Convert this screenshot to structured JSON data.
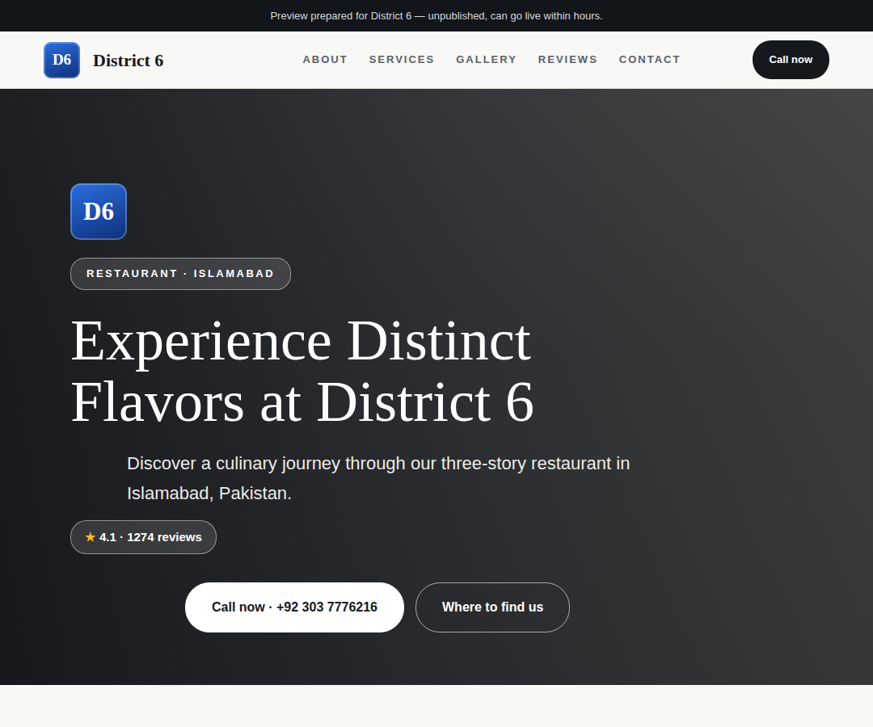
{
  "banner": "Preview prepared for District 6 — unpublished, can go live within hours.",
  "brand": {
    "logo": "D6",
    "name": "District 6"
  },
  "nav": [
    {
      "label": "ABOUT"
    },
    {
      "label": "SERVICES"
    },
    {
      "label": "GALLERY"
    },
    {
      "label": "REVIEWS"
    },
    {
      "label": "CONTACT"
    }
  ],
  "nav_cta": "Call now",
  "hero": {
    "logo": "D6",
    "tag": "RESTAURANT · ISLAMABAD",
    "title": "Experience Distinct Flavors at District 6",
    "subtitle": "Discover a culinary journey through our three-story restaurant in Islamabad, Pakistan.",
    "rating": {
      "star": "★",
      "text": "4.1 · 1274 reviews"
    },
    "buttons": [
      {
        "label": "Call now · +92 303 7776216",
        "kind": "primary"
      },
      {
        "label": "Where to find us",
        "kind": "outline"
      }
    ]
  }
}
